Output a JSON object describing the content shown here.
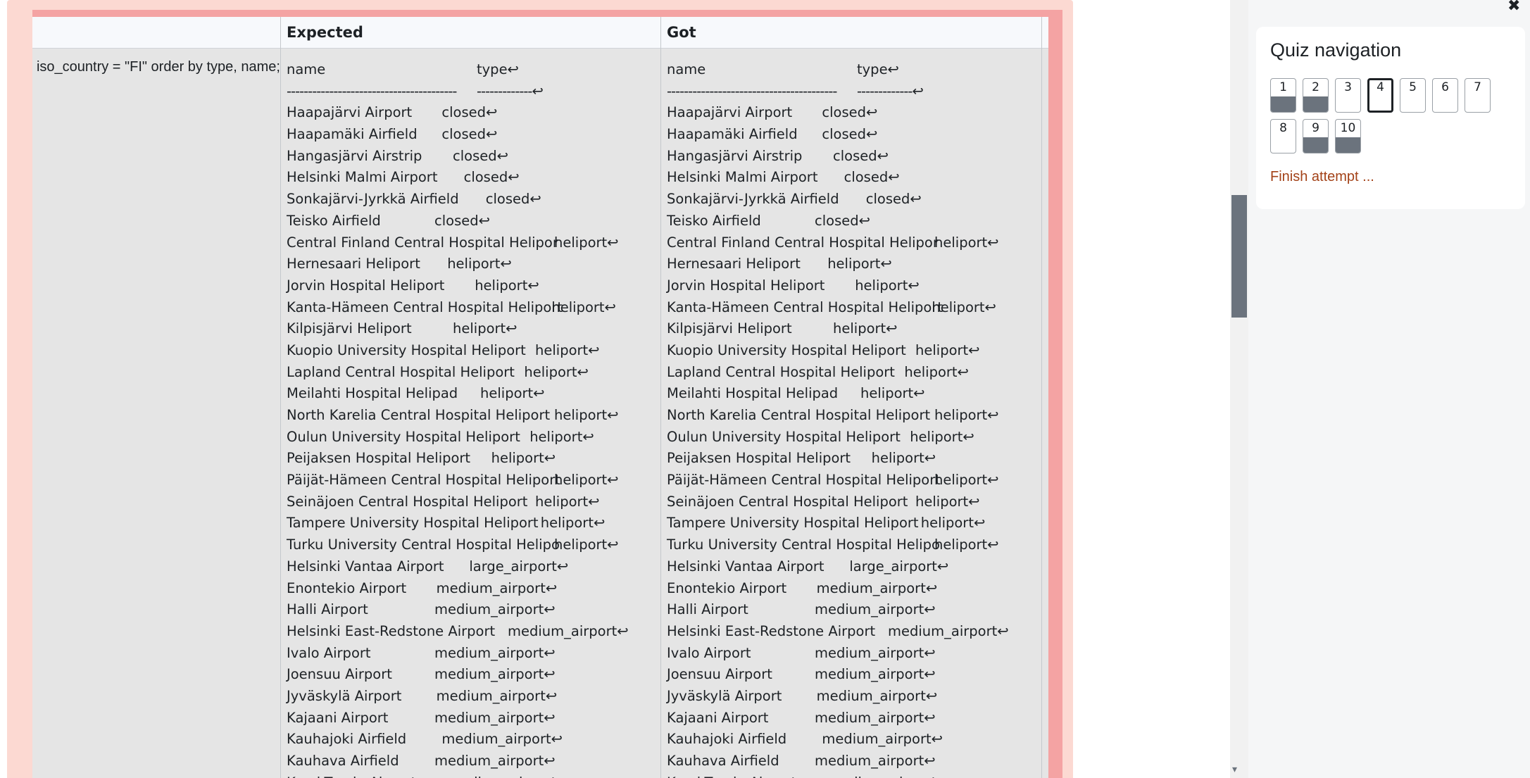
{
  "table": {
    "header_expected": "Expected",
    "header_got": "Got",
    "test_code": "SELECT name, type FROM airport WHERE iso_country = \"FI\" order by type, name;",
    "return_glyph": "↩",
    "header_row": {
      "name": "name",
      "type": "type"
    },
    "separator": {
      "name": "----------------------------------------",
      "type": "-------------"
    },
    "rows": [
      {
        "name": "Haapajärvi Airport",
        "type": "closed"
      },
      {
        "name": "Haapamäki Airfield",
        "type": "closed"
      },
      {
        "name": "Hangasjärvi Airstrip",
        "type": "closed"
      },
      {
        "name": "Helsinki Malmi Airport",
        "type": "closed"
      },
      {
        "name": "Sonkajärvi-Jyrkkä Airfield",
        "type": "closed"
      },
      {
        "name": "Teisko Airfield",
        "type": "closed"
      },
      {
        "name": "Central Finland Central Hospital Helipor",
        "type": "heliport"
      },
      {
        "name": "Hernesaari Heliport",
        "type": "heliport"
      },
      {
        "name": "Jorvin Hospital Heliport",
        "type": "heliport"
      },
      {
        "name": "Kanta-Hämeen Central Hospital Heliport",
        "type": "heliport"
      },
      {
        "name": "Kilpisjärvi Heliport",
        "type": "heliport"
      },
      {
        "name": "Kuopio University Hospital Heliport",
        "type": "heliport"
      },
      {
        "name": "Lapland Central Hospital Heliport",
        "type": "heliport"
      },
      {
        "name": "Meilahti Hospital Helipad",
        "type": "heliport"
      },
      {
        "name": "North Karelia Central Hospital Heliport",
        "type": "heliport"
      },
      {
        "name": "Oulun University Hospital Heliport",
        "type": "heliport"
      },
      {
        "name": "Peijaksen Hospital Heliport",
        "type": "heliport"
      },
      {
        "name": "Päijät-Hämeen Central Hospital Heliport",
        "type": "heliport"
      },
      {
        "name": "Seinäjoen Central Hospital Heliport",
        "type": "heliport"
      },
      {
        "name": "Tampere University Hospital Heliport",
        "type": "heliport"
      },
      {
        "name": "Turku University Central Hospital Helipo",
        "type": "heliport"
      },
      {
        "name": "Helsinki Vantaa Airport",
        "type": "large_airport"
      },
      {
        "name": "Enontekio Airport",
        "type": "medium_airport"
      },
      {
        "name": "Halli Airport",
        "type": "medium_airport"
      },
      {
        "name": "Helsinki East-Redstone Airport",
        "type": "medium_airport"
      },
      {
        "name": "Ivalo Airport",
        "type": "medium_airport"
      },
      {
        "name": "Joensuu Airport",
        "type": "medium_airport"
      },
      {
        "name": "Jyväskylä Airport",
        "type": "medium_airport"
      },
      {
        "name": "Kajaani Airport",
        "type": "medium_airport"
      },
      {
        "name": "Kauhajoki Airfield",
        "type": "medium_airport"
      },
      {
        "name": "Kauhava Airfield",
        "type": "medium_airport"
      },
      {
        "name": "Kemi-Tornio Airport",
        "type": "medium_airport"
      }
    ]
  },
  "quiz_nav": {
    "title": "Quiz navigation",
    "finish_label": "Finish attempt ...",
    "close_glyph": "✖",
    "current": 4,
    "buttons": [
      {
        "label": "1",
        "answered": true
      },
      {
        "label": "2",
        "answered": true
      },
      {
        "label": "3",
        "answered": false
      },
      {
        "label": "4",
        "answered": false
      },
      {
        "label": "5",
        "answered": false
      },
      {
        "label": "6",
        "answered": false
      },
      {
        "label": "7",
        "answered": false
      },
      {
        "label": "8",
        "answered": false
      },
      {
        "label": "9",
        "answered": true
      },
      {
        "label": "10",
        "answered": true
      }
    ]
  },
  "scroll": {
    "arrow_down": "▾"
  }
}
